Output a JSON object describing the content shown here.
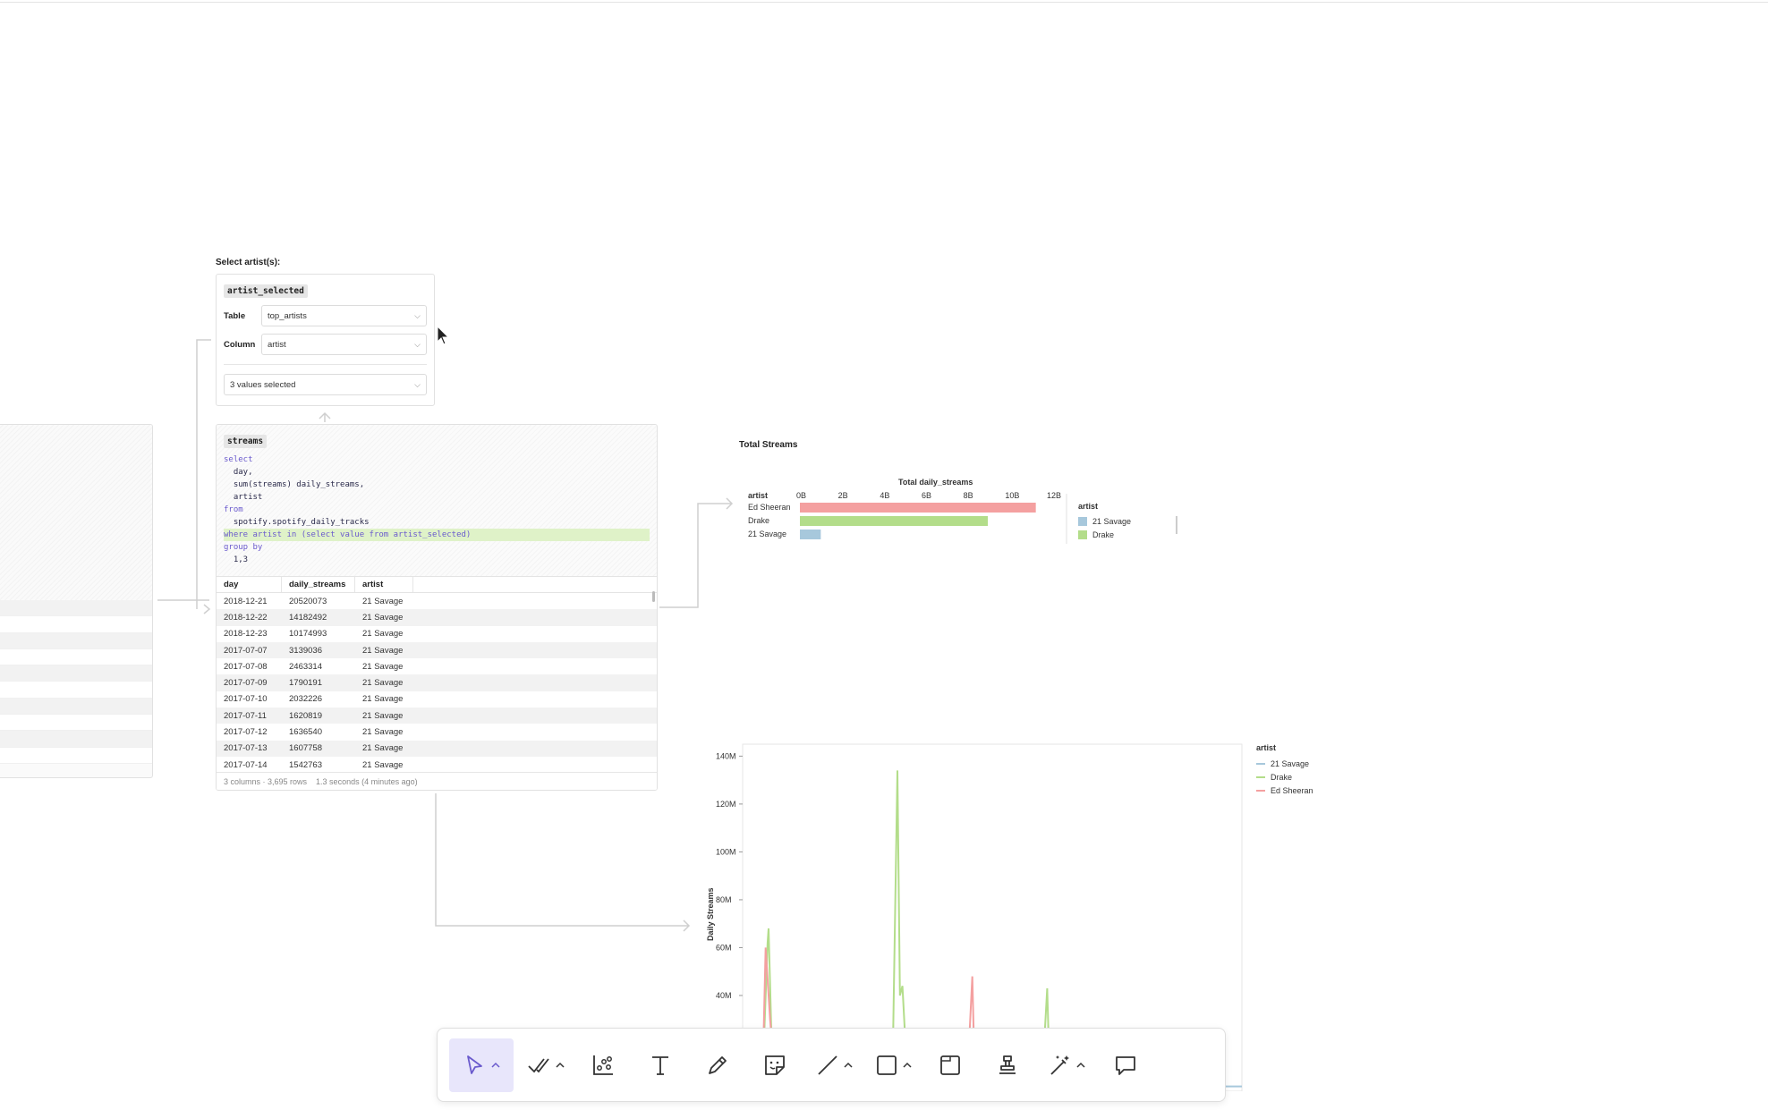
{
  "selector": {
    "heading": "Select artist(s):",
    "chip": "artist_selected",
    "table_label": "Table",
    "table_value": "top_artists",
    "column_label": "Column",
    "column_value": "artist",
    "values_selected": "3 values selected"
  },
  "streams": {
    "chip": "streams",
    "code_lines": [
      "select",
      "  day,",
      "  sum(streams) daily_streams,",
      "  artist",
      "from",
      "  spotify.spotify_daily_tracks",
      "where artist in (select value from artist_selected)",
      "group by",
      "  1,3"
    ],
    "columns": [
      "day",
      "daily_streams",
      "artist"
    ],
    "rows": [
      [
        "2018-12-21",
        "20520073",
        "21 Savage"
      ],
      [
        "2018-12-22",
        "14182492",
        "21 Savage"
      ],
      [
        "2018-12-23",
        "10174993",
        "21 Savage"
      ],
      [
        "2017-07-07",
        "3139036",
        "21 Savage"
      ],
      [
        "2017-07-08",
        "2463314",
        "21 Savage"
      ],
      [
        "2017-07-09",
        "1790191",
        "21 Savage"
      ],
      [
        "2017-07-10",
        "2032226",
        "21 Savage"
      ],
      [
        "2017-07-11",
        "1620819",
        "21 Savage"
      ],
      [
        "2017-07-12",
        "1636540",
        "21 Savage"
      ],
      [
        "2017-07-13",
        "1607758",
        "21 Savage"
      ],
      [
        "2017-07-14",
        "1542763",
        "21 Savage"
      ]
    ],
    "footer_shape": "3 columns · 3,695 rows",
    "footer_time": "1.3 seconds (4 minutes ago)"
  },
  "colors": {
    "savage": "#a7c8dc",
    "drake": "#b3dd8a",
    "ed_sheeran": "#f4a0a0",
    "accent": "#6a5acd",
    "active_tool_bg": "#e8e6fb"
  },
  "chart_data": [
    {
      "type": "bar",
      "orientation": "horizontal",
      "title": "Total Streams",
      "xlabel": "Total daily_streams",
      "ylabel": "artist",
      "categories": [
        "Ed Sheeran",
        "Drake",
        "21 Savage"
      ],
      "values": [
        11300000000,
        9000000000,
        1000000000
      ],
      "colors": [
        "#f4a0a0",
        "#b3dd8a",
        "#a7c8dc"
      ],
      "xticks": [
        "0B",
        "2B",
        "4B",
        "6B",
        "8B",
        "10B",
        "12B"
      ],
      "xlim": [
        0,
        12000000000
      ],
      "legend": {
        "title": "artist",
        "entries": [
          "21 Savage",
          "Drake"
        ],
        "placement": "right"
      }
    },
    {
      "type": "line",
      "ylabel": "Daily Streams",
      "yticks": [
        "40M",
        "60M",
        "80M",
        "100M",
        "120M",
        "140M"
      ],
      "ylim": [
        0,
        145
      ],
      "legend": {
        "title": "artist",
        "entries": [
          "21 Savage",
          "Drake",
          "Ed Sheeran"
        ],
        "placement": "top-right"
      },
      "series": [
        {
          "name": "21 Savage",
          "color": "#a7c8dc",
          "points": [
            [
              0,
              2
            ],
            [
              100,
              2
            ]
          ]
        },
        {
          "name": "Drake",
          "color": "#b3dd8a",
          "points": [
            [
              4,
              5
            ],
            [
              5,
              62
            ],
            [
              5.2,
              68
            ],
            [
              6,
              5
            ],
            [
              30,
              5
            ],
            [
              31,
              134
            ],
            [
              31.5,
              40
            ],
            [
              32,
              44
            ],
            [
              33,
              5
            ],
            [
              60,
              5
            ],
            [
              61,
              43
            ],
            [
              61.5,
              5
            ],
            [
              90,
              5
            ],
            [
              92,
              10
            ]
          ]
        },
        {
          "name": "Ed Sheeran",
          "color": "#f4a0a0",
          "points": [
            [
              4,
              5
            ],
            [
              4.6,
              60
            ],
            [
              5.5,
              30
            ],
            [
              6.5,
              5
            ],
            [
              45,
              5
            ],
            [
              46,
              48
            ],
            [
              46.5,
              5
            ]
          ]
        }
      ]
    }
  ],
  "toolbar": {
    "tools": [
      "select-tool",
      "checklist-tool",
      "visualize-tool",
      "text-tool",
      "pen-tool",
      "sticker-tool",
      "line-tool",
      "shape-tool",
      "frame-tool",
      "stamp-tool",
      "magic-tool",
      "comment-tool"
    ]
  }
}
